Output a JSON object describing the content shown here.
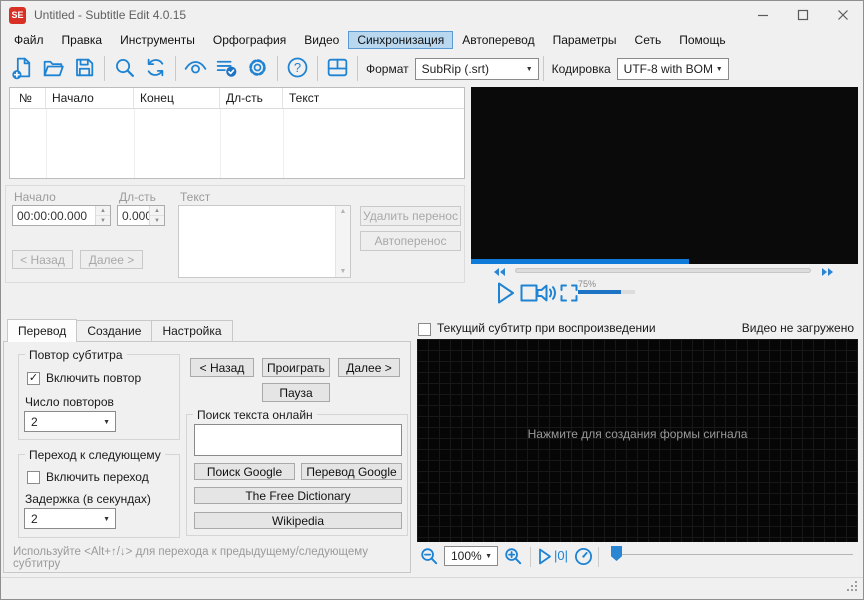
{
  "window": {
    "logo_text": "SE",
    "title": "Untitled - Subtitle Edit 4.0.15"
  },
  "menu": {
    "items": [
      "Файл",
      "Правка",
      "Инструменты",
      "Орфография",
      "Видео",
      "Синхронизация",
      "Автоперевод",
      "Параметры",
      "Сеть",
      "Помощь"
    ],
    "active_item": "Синхронизация"
  },
  "toolbar": {
    "format_label": "Формат",
    "format_value": "SubRip (.srt)",
    "encoding_label": "Кодировка",
    "encoding_value": "UTF-8 with BOM",
    "icons": [
      "new-file",
      "open-file",
      "save",
      "find",
      "replace",
      "visual-sync",
      "spell-check",
      "settings",
      "help",
      "choose-layout"
    ]
  },
  "subtitle_list": {
    "columns": [
      "№",
      "Начало",
      "Конец",
      "Дл-сть",
      "Текст"
    ],
    "rows": []
  },
  "edit_panel": {
    "start_label": "Начало",
    "start_value": "00:00:00.000",
    "duration_label": "Дл-сть",
    "duration_value": "0.000",
    "text_label": "Текст",
    "remove_break_button": "Удалить перенос",
    "auto_break_button": "Автоперенос",
    "prev_button": "< Назад",
    "next_button": "Далее >"
  },
  "video_player": {
    "volume_percent": "75%"
  },
  "bottom_tabs": {
    "tabs": [
      "Перевод",
      "Создание",
      "Настройка"
    ],
    "active_tab": "Перевод"
  },
  "translate_tab": {
    "repeat_group_title": "Повтор субтитра",
    "repeat_checkbox_label": "Включить повтор",
    "repeat_checked": true,
    "repeat_count_label": "Число повторов",
    "repeat_count_value": "2",
    "next_group_title": "Переход к следующему",
    "next_checkbox_label": "Включить переход",
    "next_checked": false,
    "delay_label": "Задержка (в секундах)",
    "delay_value": "2",
    "back_button": "< Назад",
    "play_button": "Проиграть",
    "forward_button": "Далее >",
    "pause_button": "Пауза",
    "search_group_title": "Поиск текста онлайн",
    "search_input_value": "",
    "google_search_button": "Поиск Google",
    "google_translate_button": "Перевод Google",
    "free_dictionary_button": "The Free Dictionary",
    "wikipedia_button": "Wikipedia",
    "hint": "Используйте <Alt+↑/↓> для перехода к предыдущему/следующему субтитру"
  },
  "waveform_panel": {
    "show_subtitle_label": "Текущий субтитр при воспроизведении",
    "video_status": "Видео не загружено",
    "placeholder": "Нажмите для создания формы сигнала",
    "zoom_value": "100%",
    "position_label": "|0|"
  },
  "colors": {
    "accent_blue": "#1e83d3",
    "logo_red": "#d93025",
    "menu_highlight": "#b9d7ef",
    "video_progress_blue": "#0f7ad8"
  }
}
